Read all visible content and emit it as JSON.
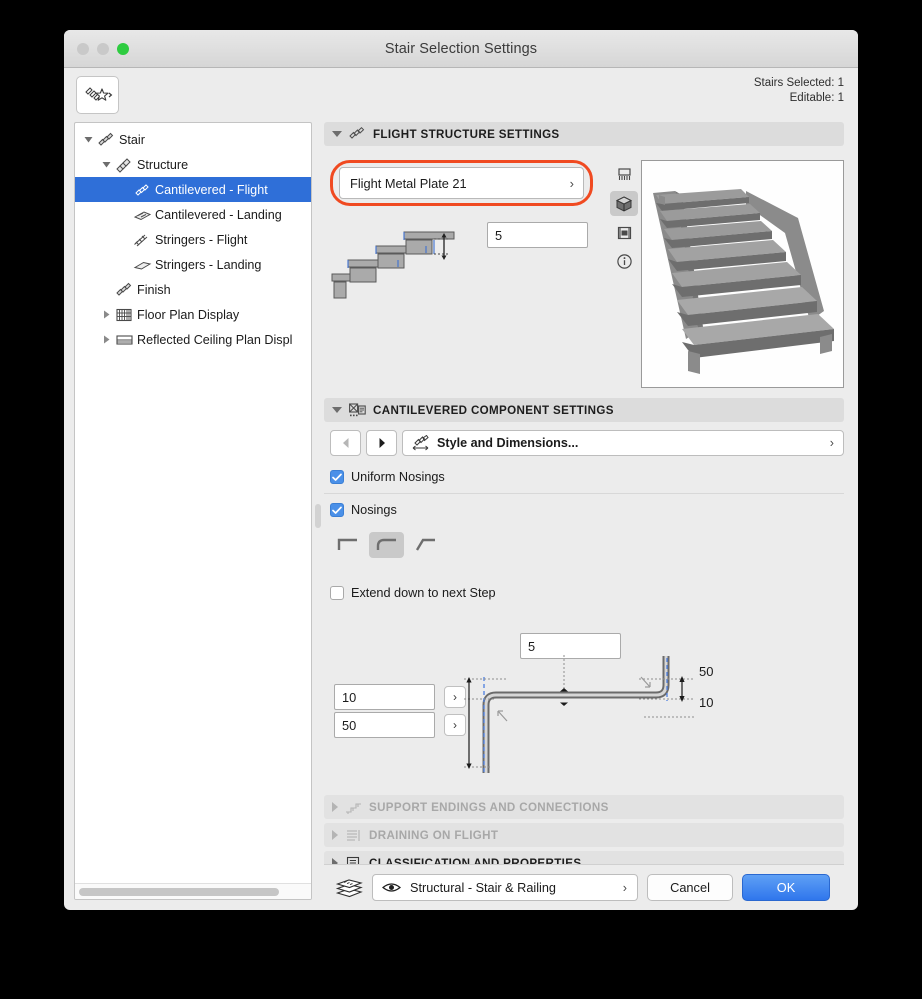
{
  "window": {
    "title": "Stair Selection Settings",
    "traffic_lights": [
      "close-red",
      "minimize-yellow",
      "zoom-green"
    ]
  },
  "toolbar": {
    "favorites_icon": "stair-favorites-star-icon",
    "stairs_selected": "Stairs Selected: 1",
    "editable": "Editable: 1"
  },
  "sidebar": {
    "items": [
      {
        "label": "Stair",
        "depth": 0,
        "twisty": "down",
        "icon": "stair-icon",
        "selected": false
      },
      {
        "label": "Structure",
        "depth": 1,
        "twisty": "down",
        "icon": "structure-icon",
        "selected": false
      },
      {
        "label": "Cantilevered - Flight",
        "depth": 2,
        "twisty": "none",
        "icon": "cantilevered-flight-icon",
        "selected": true
      },
      {
        "label": "Cantilevered - Landing",
        "depth": 2,
        "twisty": "none",
        "icon": "cantilevered-landing-icon",
        "selected": false
      },
      {
        "label": "Stringers - Flight",
        "depth": 2,
        "twisty": "none",
        "icon": "stringers-flight-icon",
        "selected": false
      },
      {
        "label": "Stringers - Landing",
        "depth": 2,
        "twisty": "none",
        "icon": "stringers-landing-icon",
        "selected": false
      },
      {
        "label": "Finish",
        "depth": 1,
        "twisty": "none",
        "icon": "finish-icon",
        "selected": false
      },
      {
        "label": "Floor Plan Display",
        "depth": 1,
        "twisty": "right",
        "icon": "floor-plan-display-icon",
        "selected": false
      },
      {
        "label": "Reflected Ceiling Plan Displ",
        "depth": 1,
        "twisty": "right",
        "icon": "reflected-ceiling-plan-icon",
        "selected": false
      }
    ],
    "selection_color": "#2f6fd8"
  },
  "flight_structure": {
    "header": "FLIGHT STRUCTURE SETTINGS",
    "header_icon": "flight-structure-icon",
    "expanded": true,
    "component_combo": {
      "value": "Flight Metal Plate 21",
      "chevron": "›",
      "highlight_color": "#f04a21"
    },
    "thickness_value": "5",
    "view_icons": [
      {
        "name": "plan-view-icon",
        "active": false
      },
      {
        "name": "3d-view-icon",
        "active": true
      },
      {
        "name": "section-view-icon",
        "active": false
      },
      {
        "name": "info-icon",
        "active": false
      }
    ],
    "preview_name": "stair-3d-preview"
  },
  "cantilevered": {
    "header": "CANTILEVERED COMPONENT SETTINGS",
    "header_icon": "cantilevered-component-icon",
    "expanded": true,
    "prev_button": "◀",
    "next_button": "▶",
    "style_field": {
      "label": "Style and Dimensions...",
      "icon": "style-dimensions-icon",
      "chevron": "›"
    },
    "uniform_nosings": {
      "label": "Uniform Nosings",
      "checked": true
    },
    "nosings": {
      "label": "Nosings",
      "checked": true
    },
    "nosing_shapes": [
      {
        "name": "nosing-square-icon",
        "active": false
      },
      {
        "name": "nosing-round-icon",
        "active": true
      },
      {
        "name": "nosing-chamfer-icon",
        "active": false
      }
    ],
    "extend_down": {
      "label": "Extend down to next Step",
      "checked": false
    },
    "profile": {
      "top_value": "5",
      "left_value_1": "10",
      "left_value_2": "50",
      "right_label_1": "50",
      "right_label_2": "10",
      "stepper_chevron": "›"
    }
  },
  "collapsed_sections": [
    {
      "header": "SUPPORT ENDINGS AND CONNECTIONS",
      "icon": "support-endings-icon",
      "disabled": true
    },
    {
      "header": "DRAINING ON FLIGHT",
      "icon": "draining-icon",
      "disabled": true
    },
    {
      "header": "CLASSIFICATION AND PROPERTIES",
      "icon": "classification-icon",
      "disabled": false
    }
  ],
  "footer": {
    "layers_icon": "layers-icon",
    "eye_icon": "eye-icon",
    "layer_value": "Structural - Stair & Railing",
    "layer_chevron": "›",
    "cancel_label": "Cancel",
    "ok_label": "OK",
    "ok_color": "#2f76ec"
  }
}
